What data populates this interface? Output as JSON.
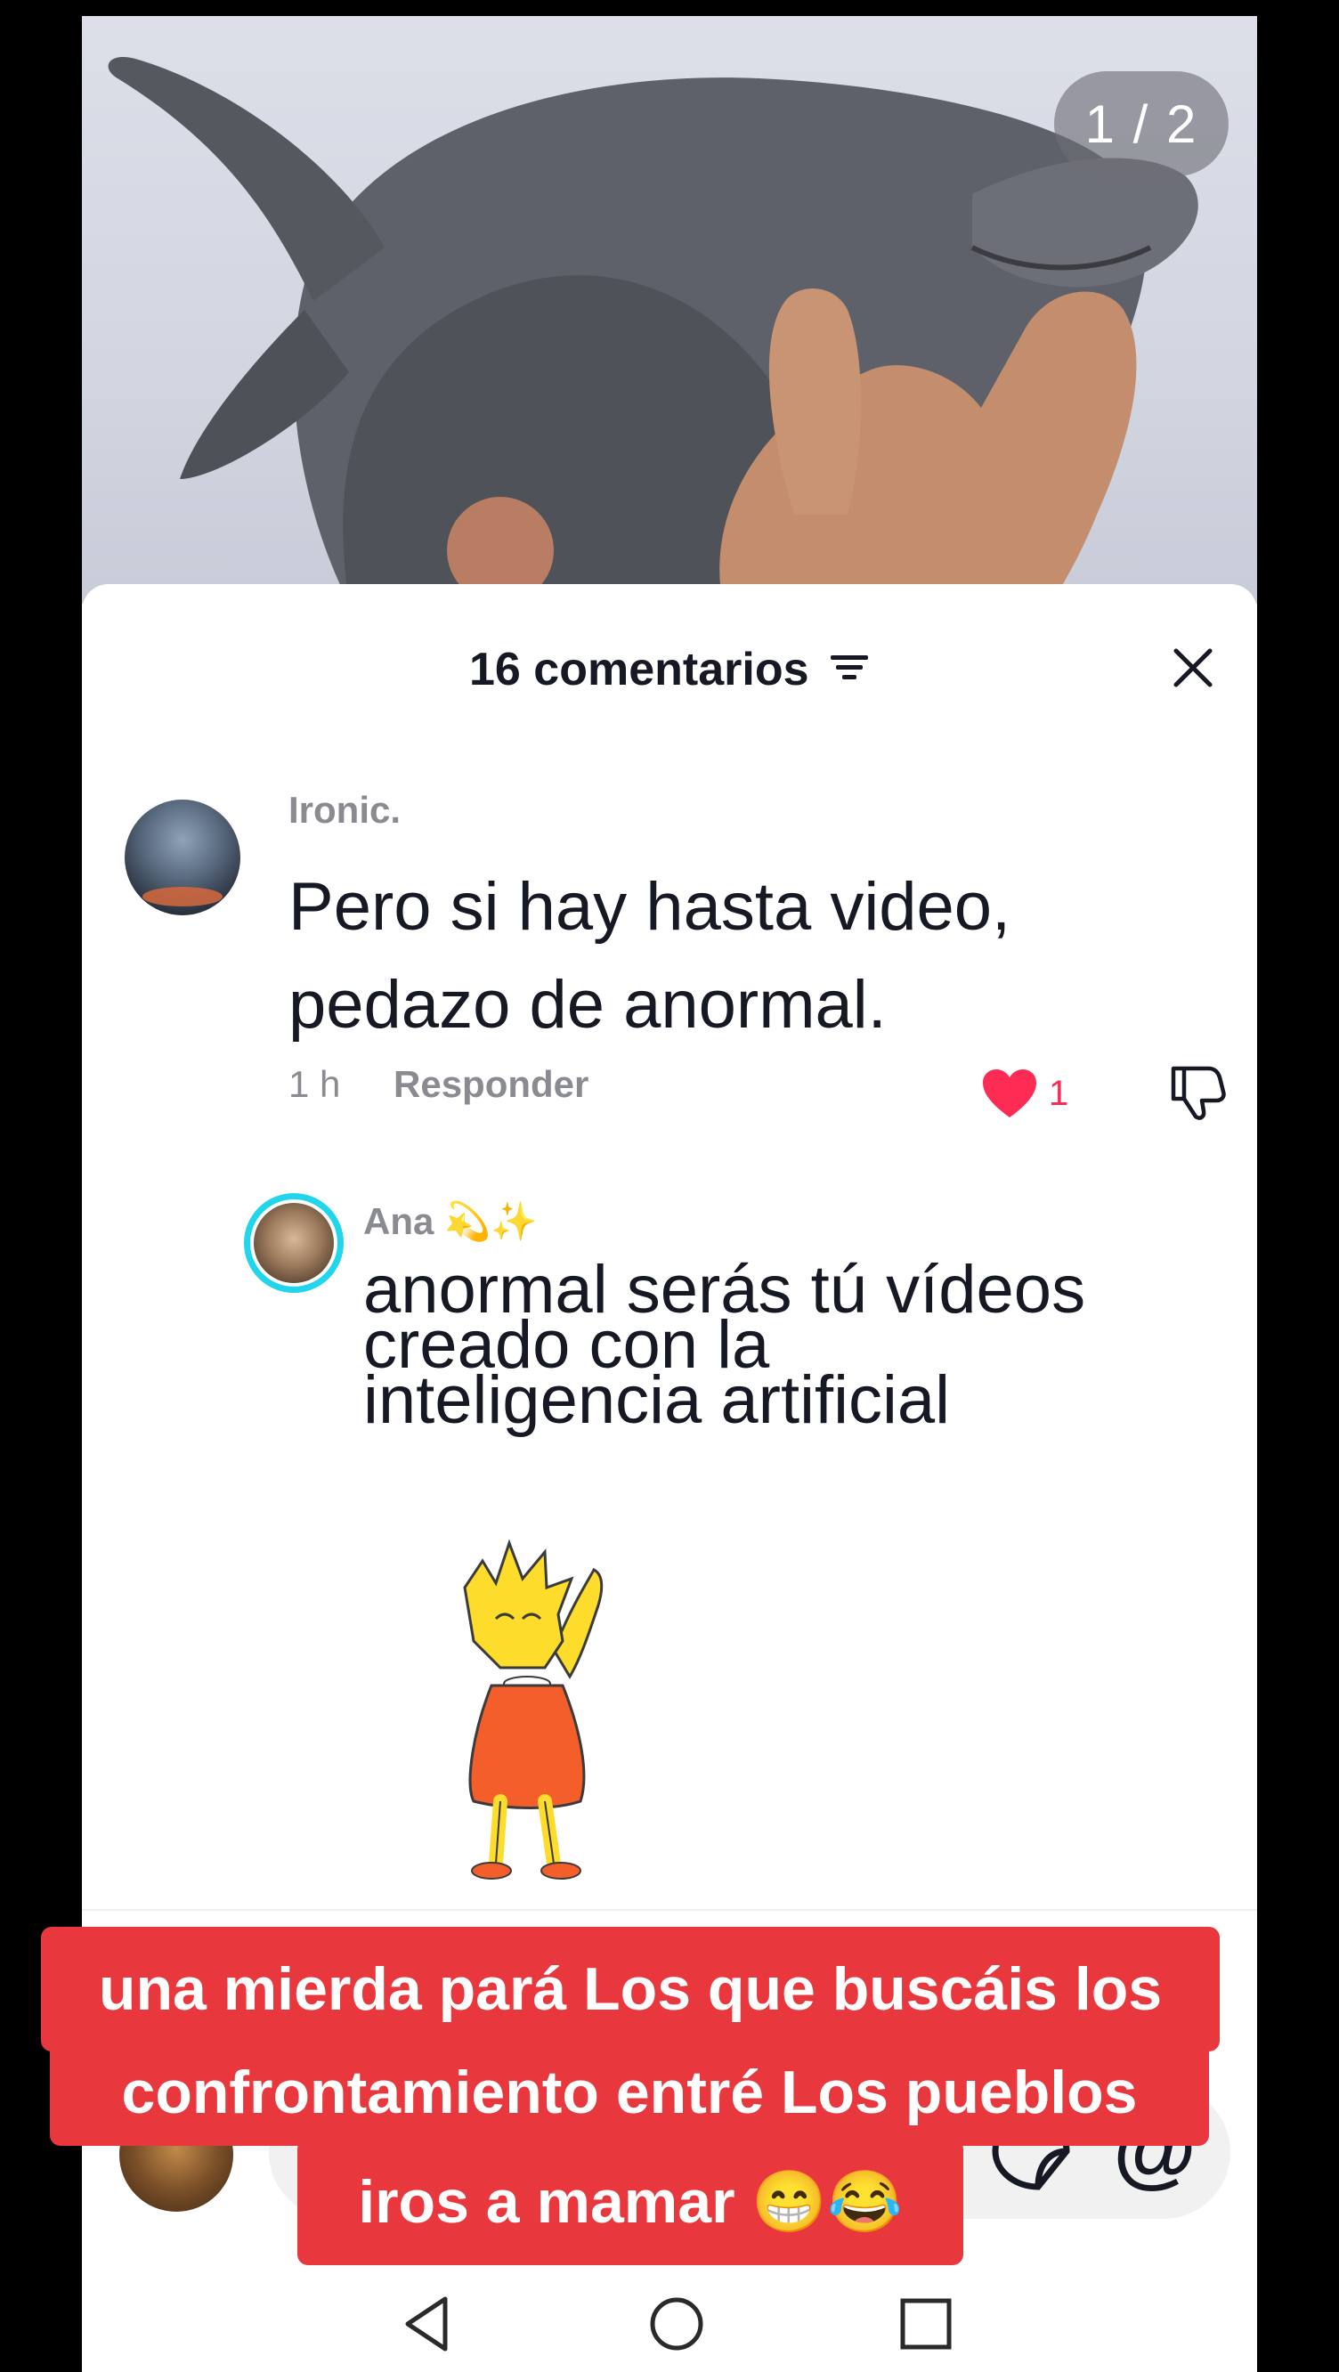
{
  "media": {
    "page_indicator": "1 / 2"
  },
  "comments_sheet": {
    "title": "16 comentarios",
    "comments": [
      {
        "username": "Ironic.",
        "line1": "Pero si hay hasta video,",
        "line2": "pedazo de anormal.",
        "time": "1 h",
        "reply_label": "Responder",
        "like_count": "1",
        "liked": true
      }
    ],
    "replies": [
      {
        "username": "Ana 💫✨",
        "line1": "anormal serás tú vídeos",
        "line2": "creado con la",
        "line3": "inteligencia artificial"
      }
    ]
  },
  "caption": {
    "line1": "una mierda pará Los que buscáis los",
    "line2": "confrontamiento entré Los pueblos",
    "line3": "iros a mamar 😁😂"
  },
  "colors": {
    "caption_bg": "#e8383d",
    "like_red": "#fe2c55",
    "ring_cyan": "#20d5ec",
    "text_dark": "#161823",
    "text_gray": "#8a8b91"
  },
  "icons": {
    "sort": "filter-lines-icon",
    "close": "close-x-icon",
    "like": "heart-filled-icon",
    "dislike": "thumbs-down-icon",
    "sticker": "sticker-icon",
    "mention": "at-sign-icon",
    "nav_back": "triangle-back-icon",
    "nav_home": "circle-home-icon",
    "nav_recent": "square-recent-icon"
  }
}
